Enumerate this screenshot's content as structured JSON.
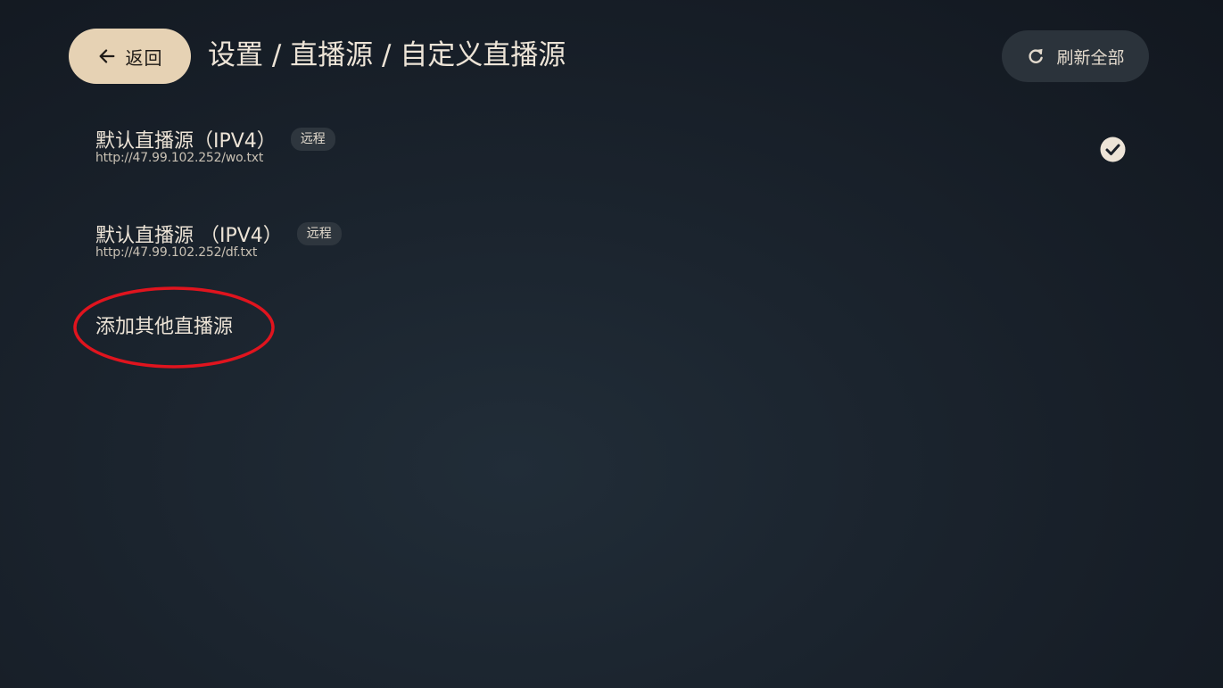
{
  "header": {
    "back_label": "返回",
    "breadcrumb": "设置 / 直播源 / 自定义直播源",
    "refresh_label": "刷新全部"
  },
  "sources": [
    {
      "name": "默认直播源（IPV4）",
      "badge": "远程",
      "url": "http://47.99.102.252/wo.txt",
      "selected": true
    },
    {
      "name": "默认直播源 （IPV4）",
      "badge": "远程",
      "url": "http://47.99.102.252/df.txt",
      "selected": false
    }
  ],
  "add_source_label": "添加其他直播源",
  "colors": {
    "accent": "#e6d2b4",
    "annotation": "#e0141e",
    "text": "#ece3d6"
  },
  "icons": {
    "back": "arrow-left-icon",
    "refresh": "refresh-icon",
    "selected": "check-circle-icon"
  }
}
